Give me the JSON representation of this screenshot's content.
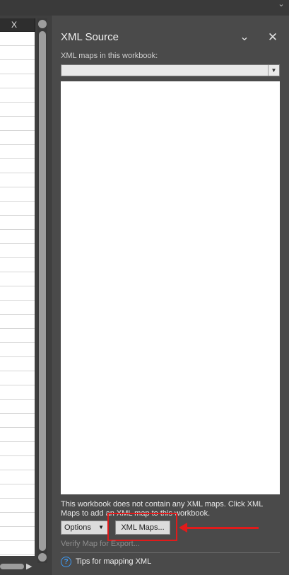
{
  "sheet": {
    "column_header": "X"
  },
  "pane": {
    "title": "XML Source",
    "maps_label": "XML maps in this workbook:",
    "selected_map": "",
    "info_text": "This workbook does not contain any XML maps. Click XML Maps to add an XML map to this workbook.",
    "options_label": "Options",
    "xml_maps_label": "XML Maps...",
    "verify_label": "Verify Map for Export...",
    "tips_label": "Tips for mapping XML"
  },
  "colors": {
    "annotation": "#e01b1b",
    "help_icon": "#3e9bf5"
  },
  "icons": [
    "chevron-down-icon",
    "close-icon",
    "dropdown-arrow-icon",
    "help-icon"
  ]
}
